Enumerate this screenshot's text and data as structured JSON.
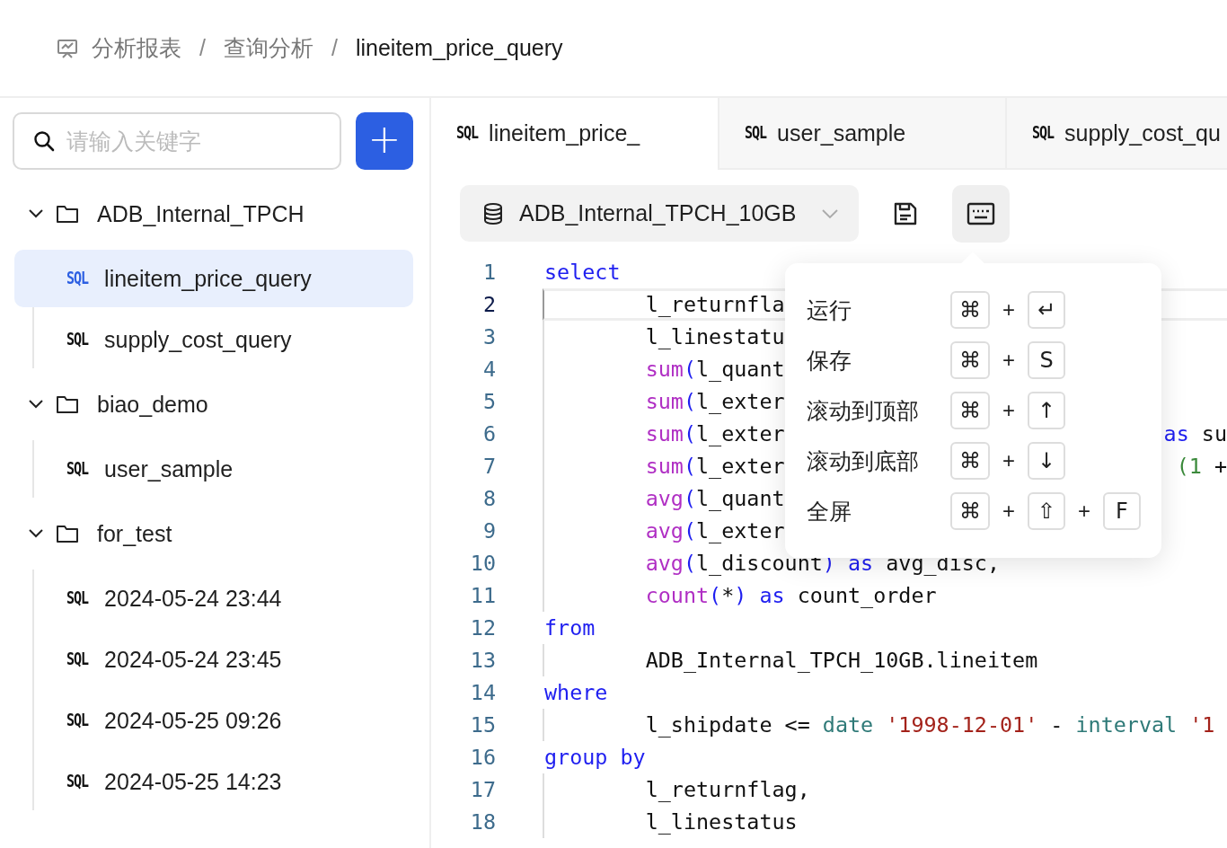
{
  "breadcrumb": [
    {
      "text": "分析报表",
      "current": false
    },
    {
      "text": "查询分析",
      "current": false
    },
    {
      "text": "lineitem_price_query",
      "current": true
    }
  ],
  "breadcrumb_separators": [
    "/",
    "/"
  ],
  "search": {
    "placeholder": "请输入关键字"
  },
  "add_button": {
    "text": "+"
  },
  "tree": [
    {
      "name": "ADB_Internal_TPCH",
      "expanded": true,
      "children": [
        {
          "badge": "SQL",
          "name": "lineitem_price_query",
          "selected": true
        },
        {
          "badge": "SQL",
          "name": "supply_cost_query",
          "selected": false
        }
      ]
    },
    {
      "name": "biao_demo",
      "expanded": true,
      "children": [
        {
          "badge": "SQL",
          "name": "user_sample",
          "selected": false
        }
      ]
    },
    {
      "name": "for_test",
      "expanded": true,
      "children": [
        {
          "badge": "SQL",
          "name": "2024-05-24 23:44",
          "selected": false
        },
        {
          "badge": "SQL",
          "name": "2024-05-24 23:45",
          "selected": false
        },
        {
          "badge": "SQL",
          "name": "2024-05-25 09:26",
          "selected": false
        },
        {
          "badge": "SQL",
          "name": "2024-05-25 14:23",
          "selected": false
        }
      ]
    }
  ],
  "tabs": [
    {
      "badge": "SQL",
      "label": "lineitem_price_",
      "selected": true
    },
    {
      "badge": "SQL",
      "label": "user_sample",
      "selected": false
    },
    {
      "badge": "SQL",
      "label": "supply_cost_qu",
      "selected": false
    }
  ],
  "toolbar": {
    "database": "ADB_Internal_TPCH_10GB",
    "shortcuts_open": true
  },
  "code_lines": [
    {
      "number": "1",
      "current": false,
      "block": false,
      "tokens": [
        {
          "kind": "kw",
          "text": "select"
        }
      ]
    },
    {
      "number": "2",
      "current": true,
      "block": true,
      "tokens": [
        {
          "kind": "plain",
          "text": "l_returnfla"
        }
      ]
    },
    {
      "number": "3",
      "current": false,
      "block": true,
      "tokens": [
        {
          "kind": "plain",
          "text": "l_linestatu"
        }
      ]
    },
    {
      "number": "4",
      "current": false,
      "block": true,
      "tokens": [
        {
          "kind": "fn",
          "text": "sum"
        },
        {
          "kind": "paren",
          "text": "("
        },
        {
          "kind": "plain",
          "text": "l_quant"
        }
      ]
    },
    {
      "number": "5",
      "current": false,
      "block": true,
      "tokens": [
        {
          "kind": "fn",
          "text": "sum"
        },
        {
          "kind": "paren",
          "text": "("
        },
        {
          "kind": "plain",
          "text": "l_exter"
        }
      ]
    },
    {
      "number": "6",
      "current": false,
      "block": true,
      "tokens": [
        {
          "kind": "fn",
          "text": "sum"
        },
        {
          "kind": "paren",
          "text": "("
        },
        {
          "kind": "plain",
          "text": "l_exter"
        }
      ],
      "tail": [
        {
          "kind": "kw",
          "text": "as"
        },
        {
          "kind": "plain",
          "text": " su"
        }
      ]
    },
    {
      "number": "7",
      "current": false,
      "block": true,
      "tokens": [
        {
          "kind": "fn",
          "text": "sum"
        },
        {
          "kind": "paren",
          "text": "("
        },
        {
          "kind": "plain",
          "text": "l_exter"
        }
      ],
      "tail": [
        {
          "kind": "num",
          "text": "(1"
        },
        {
          "kind": "plain",
          "text": " +"
        }
      ]
    },
    {
      "number": "8",
      "current": false,
      "block": true,
      "tokens": [
        {
          "kind": "fn",
          "text": "avg"
        },
        {
          "kind": "paren",
          "text": "("
        },
        {
          "kind": "plain",
          "text": "l_quant"
        }
      ]
    },
    {
      "number": "9",
      "current": false,
      "block": true,
      "tokens": [
        {
          "kind": "fn",
          "text": "avg"
        },
        {
          "kind": "paren",
          "text": "("
        },
        {
          "kind": "plain",
          "text": "l_exter"
        }
      ]
    },
    {
      "number": "10",
      "current": false,
      "block": true,
      "tokens": [
        {
          "kind": "fn",
          "text": "avg"
        },
        {
          "kind": "paren",
          "text": "("
        },
        {
          "kind": "plain",
          "text": "l_discount"
        },
        {
          "kind": "paren",
          "text": ")"
        },
        {
          "kind": "kw",
          "text": " as"
        },
        {
          "kind": "plain",
          "text": " avg_disc,"
        }
      ]
    },
    {
      "number": "11",
      "current": false,
      "block": true,
      "tokens": [
        {
          "kind": "fn",
          "text": "count"
        },
        {
          "kind": "paren",
          "text": "("
        },
        {
          "kind": "plain",
          "text": "*"
        },
        {
          "kind": "paren",
          "text": ")"
        },
        {
          "kind": "kw",
          "text": " as"
        },
        {
          "kind": "plain",
          "text": " count_order"
        }
      ]
    },
    {
      "number": "12",
      "current": false,
      "block": false,
      "tokens": [
        {
          "kind": "kw",
          "text": "from"
        }
      ]
    },
    {
      "number": "13",
      "current": false,
      "block": true,
      "tokens": [
        {
          "kind": "plain",
          "text": "ADB_Internal_TPCH_10GB.lineitem"
        }
      ]
    },
    {
      "number": "14",
      "current": false,
      "block": false,
      "tokens": [
        {
          "kind": "kw",
          "text": "where"
        }
      ]
    },
    {
      "number": "15",
      "current": false,
      "block": true,
      "tokens": [
        {
          "kind": "plain",
          "text": "l_shipdate <="
        },
        {
          "kind": "type",
          "text": " date"
        },
        {
          "kind": "str",
          "text": " '1998-12-01'"
        },
        {
          "kind": "plain",
          "text": " -"
        },
        {
          "kind": "type",
          "text": " interval"
        },
        {
          "kind": "str",
          "text": " '1"
        }
      ]
    },
    {
      "number": "16",
      "current": false,
      "block": false,
      "tokens": [
        {
          "kind": "kw",
          "text": "group by"
        }
      ]
    },
    {
      "number": "17",
      "current": false,
      "block": true,
      "tokens": [
        {
          "kind": "plain",
          "text": "l_returnflag,"
        }
      ]
    },
    {
      "number": "18",
      "current": false,
      "block": true,
      "tokens": [
        {
          "kind": "plain",
          "text": "l_linestatus"
        }
      ]
    }
  ],
  "shortcuts": [
    {
      "label": "运行",
      "keys": [
        {
          "kind": "key",
          "text": "⌘"
        },
        {
          "kind": "plus",
          "text": "+"
        },
        {
          "kind": "key",
          "text": "↵"
        }
      ]
    },
    {
      "label": "保存",
      "keys": [
        {
          "kind": "key",
          "text": "⌘"
        },
        {
          "kind": "plus",
          "text": "+"
        },
        {
          "kind": "key",
          "text": "S"
        }
      ]
    },
    {
      "label": "滚动到顶部",
      "keys": [
        {
          "kind": "key",
          "text": "⌘"
        },
        {
          "kind": "plus",
          "text": "+"
        },
        {
          "kind": "key",
          "text": "↑"
        }
      ]
    },
    {
      "label": "滚动到底部",
      "keys": [
        {
          "kind": "key",
          "text": "⌘"
        },
        {
          "kind": "plus",
          "text": "+"
        },
        {
          "kind": "key",
          "text": "↓"
        }
      ]
    },
    {
      "label": "全屏",
      "keys": [
        {
          "kind": "key",
          "text": "⌘"
        },
        {
          "kind": "plus",
          "text": "+"
        },
        {
          "kind": "key",
          "text": "⇧"
        },
        {
          "kind": "plus",
          "text": "+"
        },
        {
          "kind": "key",
          "text": "F"
        }
      ]
    }
  ]
}
